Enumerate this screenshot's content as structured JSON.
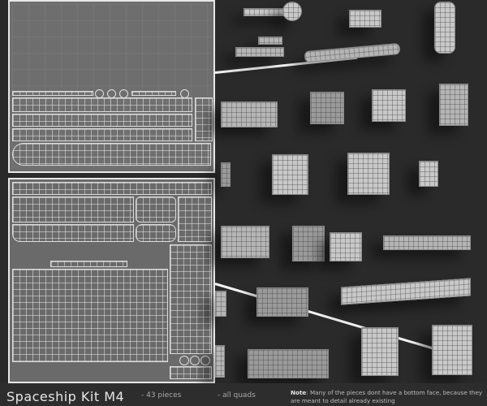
{
  "title": "Spaceship Kit M4",
  "stats": {
    "pieces": "- 43 pieces",
    "quads": "- all quads"
  },
  "note": {
    "label": "Note",
    "text": ": Many of the pieces dont have a bottom face, because they are meant to detail already existing"
  },
  "colors": {
    "background": "#2a2a2a",
    "uv_frame": "#e8e8e8",
    "uv_fill": "#6e6e6e",
    "pieces": "#b5b5b5"
  }
}
